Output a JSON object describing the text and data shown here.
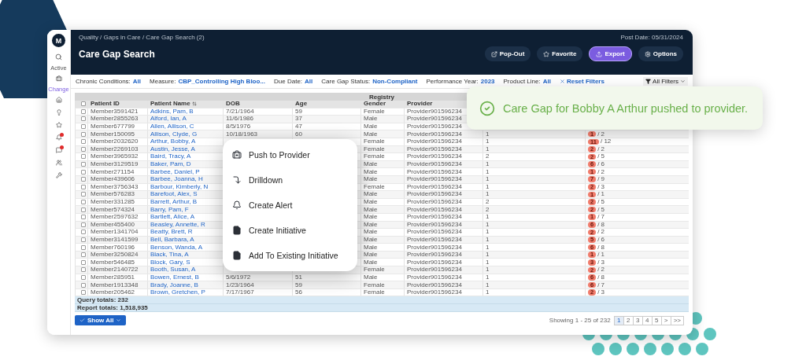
{
  "sidebar": {
    "logo": "M",
    "active_label": "Active",
    "change_label": "Change",
    "nav": [
      {
        "badge": false
      },
      {
        "badge": false
      },
      {
        "badge": false
      },
      {
        "badge": true
      },
      {
        "badge": true
      },
      {
        "badge": false
      },
      {
        "badge": false
      }
    ]
  },
  "header": {
    "breadcrumb": "Quality / Gaps in Care / Care Gap Search (2)",
    "post_date": "Post Date: 05/31/2024",
    "title": "Care Gap Search",
    "buttons": [
      {
        "label": "Pop-Out",
        "kind": "default"
      },
      {
        "label": "Favorite",
        "kind": "default"
      },
      {
        "label": "Export",
        "kind": "primary"
      },
      {
        "label": "Options",
        "kind": "default"
      }
    ]
  },
  "filters": {
    "items": [
      {
        "label": "Chronic Conditions:",
        "value": "All"
      },
      {
        "label": "Measure:",
        "value": "CBP_Controlling High Bloo..."
      },
      {
        "label": "Due Date:",
        "value": "All"
      },
      {
        "label": "Care Gap Status:",
        "value": "Non-Compliant"
      },
      {
        "label": "Performance Year:",
        "value": "2023"
      },
      {
        "label": "Product Line:",
        "value": "All"
      }
    ],
    "reset": "Reset Filters",
    "all_filters": "All Filters"
  },
  "table": {
    "group_header": "Registry",
    "select_all_checked": false,
    "columns": [
      "Patient ID",
      "Patient Name",
      "DOB",
      "Age",
      "Gender",
      "Provider"
    ],
    "rows": [
      {
        "checked": false,
        "patient_id": "Member3591421",
        "patient_name": "Adkins, Pam, B",
        "dob": "7/21/1964",
        "age": "59",
        "gender": "Female",
        "provider": "Provider901596234"
      },
      {
        "checked": false,
        "patient_id": "Member2855263",
        "patient_name": "Alford, Ian, A",
        "dob": "11/6/1986",
        "age": "37",
        "gender": "Male",
        "provider": "Provider901596234"
      },
      {
        "checked": false,
        "patient_id": "Member677799",
        "patient_name": "Allen, Allison, C",
        "dob": "8/5/1976",
        "age": "47",
        "gender": "Male",
        "provider": "Provider901596234"
      },
      {
        "checked": false,
        "patient_id": "Member150095",
        "patient_name": "Allison, Clyde, G",
        "dob": "10/18/1963",
        "age": "60",
        "gender": "Male",
        "provider": "Provider901596234",
        "column_8": "1",
        "column_9": {
          "badge": "1",
          "total": "/ 2"
        }
      },
      {
        "checked": false,
        "patient_id": "Member2032620",
        "patient_name": "Arthur, Bobby, A",
        "gender": "Female",
        "provider": "Provider901596234",
        "column_8": "1",
        "column_9": {
          "badge": "11",
          "total": "/ 12"
        }
      },
      {
        "checked": false,
        "patient_id": "Member2269103",
        "patient_name": "Austin, Jesse, A",
        "gender": "Female",
        "provider": "Provider901596234",
        "column_8": "1",
        "column_9": {
          "badge": "2",
          "total": "/ 2"
        }
      },
      {
        "checked": false,
        "patient_id": "Member3965932",
        "patient_name": "Baird, Tracy, A",
        "gender": "Female",
        "provider": "Provider901596234",
        "column_8": "2",
        "column_9": {
          "badge": "2",
          "total": "/ 5"
        }
      },
      {
        "checked": false,
        "patient_id": "Member3129519",
        "patient_name": "Baker, Pam, D",
        "gender": "Male",
        "provider": "Provider901596234",
        "column_8": "1",
        "column_9": {
          "badge": "6",
          "total": "/ 6"
        }
      },
      {
        "checked": false,
        "patient_id": "Member271154",
        "patient_name": "Barbee, Daniel, P",
        "gender": "Male",
        "provider": "Provider901596234",
        "column_8": "1",
        "column_9": {
          "badge": "1",
          "total": "/ 2"
        }
      },
      {
        "checked": false,
        "patient_id": "Member439606",
        "patient_name": "Barbee, Joanna, H",
        "gender": "Male",
        "provider": "Provider901596234",
        "column_8": "1",
        "column_9": {
          "badge": "7",
          "total": "/ 9"
        }
      },
      {
        "checked": false,
        "patient_id": "Member3756343",
        "patient_name": "Barbour, Kimberly, N",
        "gender": "Female",
        "provider": "Provider901596234",
        "column_8": "1",
        "column_9": {
          "badge": "2",
          "total": "/ 3"
        }
      },
      {
        "checked": false,
        "patient_id": "Member576283",
        "patient_name": "Barefoot, Alex, S",
        "gender": "Male",
        "provider": "Provider901596234",
        "column_8": "1",
        "column_9": {
          "badge": "1",
          "total": "/ 1"
        }
      },
      {
        "checked": false,
        "patient_id": "Member331285",
        "patient_name": "Barrett, Arthur, B",
        "gender": "Male",
        "provider": "Provider901596234",
        "column_8": "2",
        "column_9": {
          "badge": "2",
          "total": "/ 5"
        }
      },
      {
        "checked": false,
        "patient_id": "Member574324",
        "patient_name": "Barry, Pam, F",
        "gender": "Male",
        "provider": "Provider901596234",
        "column_8": "2",
        "column_9": {
          "badge": "2",
          "total": "/ 5"
        }
      },
      {
        "checked": false,
        "patient_id": "Member2597632",
        "patient_name": "Bartlett, Alice, A",
        "gender": "Male",
        "provider": "Provider901596234",
        "column_8": "1",
        "column_9": {
          "badge": "1",
          "total": "/ 7"
        }
      },
      {
        "checked": false,
        "patient_id": "Member455400",
        "patient_name": "Beasley, Annette, R",
        "gender": "Male",
        "provider": "Provider901596234",
        "column_8": "1",
        "column_9": {
          "badge": "6",
          "total": "/ 8"
        }
      },
      {
        "checked": false,
        "patient_id": "Member1341704",
        "patient_name": "Beatty, Brett, R",
        "gender": "Male",
        "provider": "Provider901596234",
        "column_8": "1",
        "column_9": {
          "badge": "2",
          "total": "/ 2"
        }
      },
      {
        "checked": false,
        "patient_id": "Member3141599",
        "patient_name": "Bell, Barbara, A",
        "gender": "Male",
        "provider": "Provider901596234",
        "column_8": "1",
        "column_9": {
          "badge": "5",
          "total": "/ 6"
        }
      },
      {
        "checked": false,
        "patient_id": "Member760196",
        "patient_name": "Benson, Wanda, A",
        "gender": "Male",
        "provider": "Provider901596234",
        "column_8": "1",
        "column_9": {
          "badge": "6",
          "total": "/ 8"
        }
      },
      {
        "checked": false,
        "patient_id": "Member3250824",
        "patient_name": "Black, Tina, A",
        "gender": "Male",
        "provider": "Provider901596234",
        "column_8": "1",
        "column_9": {
          "badge": "1",
          "total": "/ 1"
        }
      },
      {
        "checked": false,
        "patient_id": "Member546485",
        "patient_name": "Block, Gary, S",
        "gender": "Male",
        "provider": "Provider901596234",
        "column_8": "1",
        "column_9": {
          "badge": "3",
          "total": "/ 3"
        }
      },
      {
        "checked": false,
        "patient_id": "Member2140722",
        "patient_name": "Booth, Susan, A",
        "gender": "Female",
        "provider": "Provider901596234",
        "column_8": "1",
        "column_9": {
          "badge": "2",
          "total": "/ 2"
        }
      },
      {
        "checked": false,
        "patient_id": "Member285951",
        "patient_name": "Bowen, Ernest, B",
        "dob": "5/6/1972",
        "age": "51",
        "gender": "Male",
        "provider": "Provider901596234",
        "column_8": "1",
        "column_9": {
          "badge": "6",
          "total": "/ 8"
        }
      },
      {
        "checked": false,
        "patient_id": "Member1913348",
        "patient_name": "Brady, Joanne, B",
        "dob": "1/23/1964",
        "age": "59",
        "gender": "Female",
        "provider": "Provider901596234",
        "column_8": "1",
        "column_9": {
          "badge": "6",
          "total": "/ 7"
        }
      },
      {
        "checked": false,
        "patient_id": "Member205462",
        "patient_name": "Brown, Gretchen, P",
        "dob": "7/17/1967",
        "age": "56",
        "gender": "Female",
        "provider": "Provider901596234",
        "column_8": "1",
        "column_9": {
          "badge": "2",
          "total": "/ 3"
        }
      }
    ],
    "totals": [
      "Query totals: 232",
      "Report totals: 1,518,935"
    ]
  },
  "footer": {
    "show_all": "Show All",
    "showing": "Showing 1 - 25 of 232",
    "pages": [
      {
        "label": "1",
        "selected": true
      },
      {
        "label": "2",
        "selected": false
      },
      {
        "label": "3",
        "selected": false
      },
      {
        "label": "4",
        "selected": false
      },
      {
        "label": "5",
        "selected": false
      }
    ],
    "next": ">",
    "last": ">>"
  },
  "context_menu": {
    "items": [
      "Push to Provider",
      "Drilldown",
      "Create Alert",
      "Create Initiative",
      "Add To Existing Initiative"
    ]
  },
  "toast": {
    "message": "Care Gap for Bobby A Arthur pushed to provider."
  }
}
